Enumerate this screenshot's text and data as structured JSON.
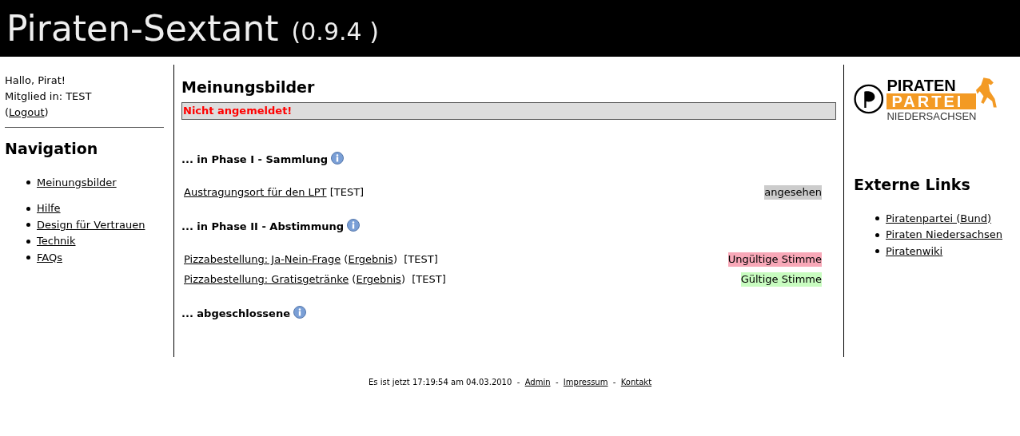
{
  "header": {
    "title": "Piraten-Sextant",
    "version": "(0.9.4 )"
  },
  "sidebar": {
    "greeting": "Hallo, Pirat!",
    "member": "Mitglied in: TEST",
    "logout_open": "(",
    "logout": "Logout",
    "logout_close": ")",
    "heading": "Navigation",
    "groups": [
      {
        "items": [
          "Meinungsbilder"
        ]
      },
      {
        "items": [
          "Hilfe",
          "Design für Vertrauen",
          "Technik",
          "FAQs"
        ]
      }
    ]
  },
  "main": {
    "title": "Meinungsbilder",
    "alert": "Nicht angemeldet!",
    "sections": [
      {
        "heading": "... in Phase I - Sammlung",
        "rows": [
          {
            "link": "Austragungsort für den LPT",
            "tag": "[TEST]",
            "status": "angesehen",
            "color": "#cccccc"
          }
        ]
      },
      {
        "heading": "... in Phase II - Abstimmung",
        "rows": [
          {
            "link": "Pizzabestellung: Ja-Nein-Frage",
            "result_open": "(",
            "result": "Ergebnis",
            "result_close": ")",
            "tag": "[TEST]",
            "status": "Ungültige Stimme",
            "color": "#f8a8b8"
          },
          {
            "link": "Pizzabestellung: Gratisgetränke",
            "result_open": "(",
            "result": "Ergebnis",
            "result_close": ")",
            "tag": "[TEST]",
            "status": "Gültige Stimme",
            "color": "#c8fcc0"
          }
        ]
      },
      {
        "heading": "... abgeschlossene"
      }
    ]
  },
  "right": {
    "logo": {
      "line1": "PIRATEN",
      "line2": "PARTEI",
      "line3": "NIEDERSACHSEN"
    },
    "heading": "Externe Links",
    "links": [
      "Piratenpartei (Bund)",
      "Piraten Niedersachsen",
      "Piratenwiki"
    ]
  },
  "footer": {
    "clock": "Es ist jetzt 17:19:54 am 04.03.2010",
    "sep1": "-",
    "admin": "Admin",
    "sep2": "-",
    "impressum": "Impressum",
    "sep3": "-",
    "kontakt": "Kontakt"
  }
}
